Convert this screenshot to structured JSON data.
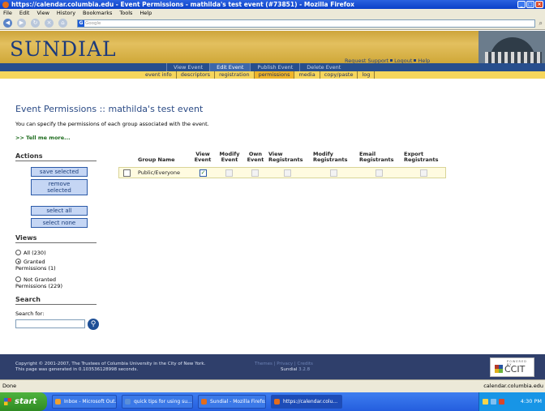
{
  "window": {
    "title": "https://calendar.columbia.edu - Event Permissions - mathilda's test event (#73851) - Mozilla Firefox"
  },
  "menu": [
    "File",
    "Edit",
    "View",
    "History",
    "Bookmarks",
    "Tools",
    "Help"
  ],
  "nav": {
    "search_placeholder": "Google",
    "search_engine_letter": "G"
  },
  "header": {
    "logo": "SUNDIAL",
    "request_support": "Request Support",
    "logout": "Logout",
    "help": "Help"
  },
  "tabs": [
    {
      "label": "View Event",
      "active": false
    },
    {
      "label": "Edit Event",
      "active": true
    },
    {
      "label": "Publish Event",
      "active": false
    },
    {
      "label": "Delete Event",
      "active": false
    }
  ],
  "subtabs": [
    {
      "label": "event info",
      "active": false
    },
    {
      "label": "descriptors",
      "active": false
    },
    {
      "label": "registration",
      "active": false
    },
    {
      "label": "permissions",
      "active": true
    },
    {
      "label": "media",
      "active": false
    },
    {
      "label": "copy/paste",
      "active": false
    },
    {
      "label": "log",
      "active": false
    }
  ],
  "page": {
    "title": "Event Permissions :: mathilda's test event",
    "intro": "You can specify the permissions of each group associated with the event.",
    "tell_me": ">> Tell me more..."
  },
  "sidebar": {
    "actions_heading": "Actions",
    "save_selected": "save selected",
    "remove_selected_line1": "remove",
    "remove_selected_line2": "selected",
    "select_all": "select all",
    "select_none": "select none",
    "views_heading": "Views",
    "view_all": "All (230)",
    "view_granted_1": "Granted",
    "view_granted_2": "Permissions (1)",
    "view_not_granted_1": "Not Granted",
    "view_not_granted_2": "Permissions (229)",
    "selected_view": "granted",
    "search_heading": "Search",
    "search_label": "Search for:",
    "search_value": ""
  },
  "table": {
    "columns": [
      {
        "l1": "Group Name",
        "l2": ""
      },
      {
        "l1": "View",
        "l2": "Event"
      },
      {
        "l1": "Modify",
        "l2": "Event"
      },
      {
        "l1": "Own",
        "l2": "Event"
      },
      {
        "l1": "View",
        "l2": "Registrants"
      },
      {
        "l1": "Modify",
        "l2": "Registrants"
      },
      {
        "l1": "Email",
        "l2": "Registrants"
      },
      {
        "l1": "Export",
        "l2": "Registrants"
      }
    ],
    "rows": [
      {
        "group": "Public/Everyone",
        "selected": false,
        "permissions": [
          true,
          false,
          false,
          false,
          false,
          false,
          false
        ]
      }
    ]
  },
  "footer": {
    "copyright": "Copyright © 2001-2007, The Trustees of Columbia University in the City of New York.",
    "generated": "This page was generated in 0.103536128998 seconds.",
    "links": [
      "Themes",
      "Privacy",
      "Credits"
    ],
    "app": "Sundial",
    "version": "3.2.8",
    "powered_by": "POWERED BY",
    "brand": "CCIT"
  },
  "status": {
    "text": "Done",
    "domain": "calendar.columbia.edu"
  },
  "taskbar": {
    "start": "start",
    "tasks": [
      {
        "label": "Inbox - Microsoft Out...",
        "active": false,
        "color": "#f0a030"
      },
      {
        "label": "quick tips for using su...",
        "active": false,
        "color": "#5b8fd8"
      },
      {
        "label": "Sundial - Mozilla Firefox",
        "active": false,
        "color": "#e36c1b"
      },
      {
        "label": "https://calendar.colu...",
        "active": true,
        "color": "#e36c1b"
      }
    ],
    "clock": "4:30 PM"
  },
  "colors": {
    "header_gold": "#cda43b",
    "tab_blue": "#274e8d",
    "subtab_yellow": "#f6d65c",
    "footer_navy": "#2f3f6b",
    "title_blue": "#2b4b86"
  }
}
